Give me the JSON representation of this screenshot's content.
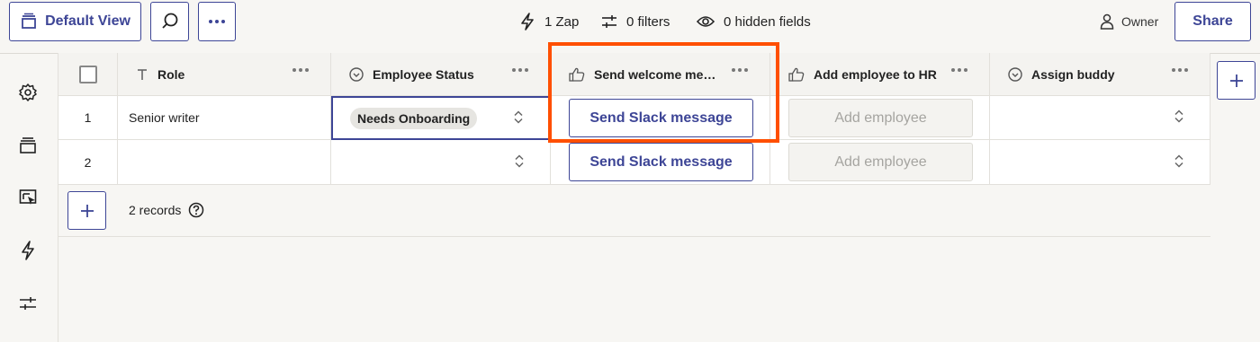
{
  "toolbar": {
    "view_label": "Default View",
    "zaps": "1 Zap",
    "filters": "0 filters",
    "hidden_fields": "0 hidden fields",
    "owner": "Owner",
    "share": "Share"
  },
  "columns": [
    {
      "name": "Role",
      "type": "text"
    },
    {
      "name": "Employee Status",
      "type": "status"
    },
    {
      "name": "Send welcome me…",
      "type": "button"
    },
    {
      "name": "Add employee to HR",
      "type": "button"
    },
    {
      "name": "Assign buddy",
      "type": "status"
    }
  ],
  "rows": [
    {
      "num": "1",
      "role": "Senior writer",
      "status": "Needs Onboarding",
      "send_welcome": "Send Slack message",
      "add_employee": "Add employee",
      "assign_buddy": ""
    },
    {
      "num": "2",
      "role": "",
      "status": "",
      "send_welcome": "Send Slack message",
      "add_employee": "Add employee",
      "assign_buddy": ""
    }
  ],
  "footer": {
    "records": "2 records"
  },
  "colors": {
    "accent": "#3d4596",
    "highlight": "#ff4f00"
  }
}
